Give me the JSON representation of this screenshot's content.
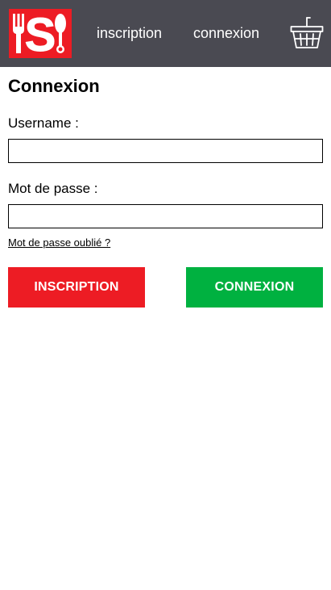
{
  "header": {
    "logo_letter": "S",
    "nav_inscription": "inscription",
    "nav_connexion": "connexion",
    "cart_icon": "basket-icon"
  },
  "main": {
    "title": "Connexion",
    "username_label": "Username :",
    "username_value": "",
    "password_label": "Mot de passe :",
    "password_value": "",
    "forgot_link": "Mot de passe oublié ?",
    "inscription_button": "INSCRIPTION",
    "connexion_button": "CONNEXION"
  },
  "colors": {
    "header_bg": "#4a4a52",
    "logo_red": "#ed1c24",
    "inscription_red": "#ed1c24",
    "connexion_green": "#00b140"
  }
}
